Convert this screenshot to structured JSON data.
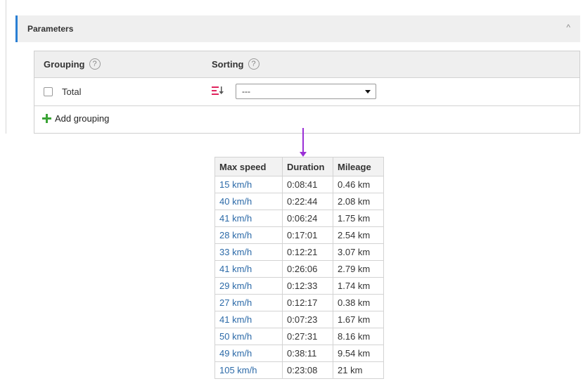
{
  "parameters": {
    "title": "Parameters",
    "collapse_icon": "chevron-up-icon",
    "collapse_glyph": "^"
  },
  "panel": {
    "grouping_label": "Grouping",
    "sorting_label": "Sorting",
    "help_glyph": "?",
    "total_label": "Total",
    "sort_select_value": "---",
    "add_grouping_label": "Add grouping"
  },
  "colors": {
    "accent": "#2a7fd4",
    "add_green": "#3aa335",
    "sort_icon_red": "#e0245e",
    "arrow_purple": "#9b30d6",
    "link_blue": "#2c6aa8"
  },
  "table": {
    "headers": [
      "Max speed",
      "Duration",
      "Mileage"
    ],
    "rows": [
      [
        "15 km/h",
        "0:08:41",
        "0.46 km"
      ],
      [
        "40 km/h",
        "0:22:44",
        "2.08 km"
      ],
      [
        "41 km/h",
        "0:06:24",
        "1.75 km"
      ],
      [
        "28 km/h",
        "0:17:01",
        "2.54 km"
      ],
      [
        "33 km/h",
        "0:12:21",
        "3.07 km"
      ],
      [
        "41 km/h",
        "0:26:06",
        "2.79 km"
      ],
      [
        "29 km/h",
        "0:12:33",
        "1.74 km"
      ],
      [
        "27 km/h",
        "0:12:17",
        "0.38 km"
      ],
      [
        "41 km/h",
        "0:07:23",
        "1.67 km"
      ],
      [
        "50 km/h",
        "0:27:31",
        "8.16 km"
      ],
      [
        "49 km/h",
        "0:38:11",
        "9.54 km"
      ],
      [
        "105 km/h",
        "0:23:08",
        "21 km"
      ]
    ]
  }
}
